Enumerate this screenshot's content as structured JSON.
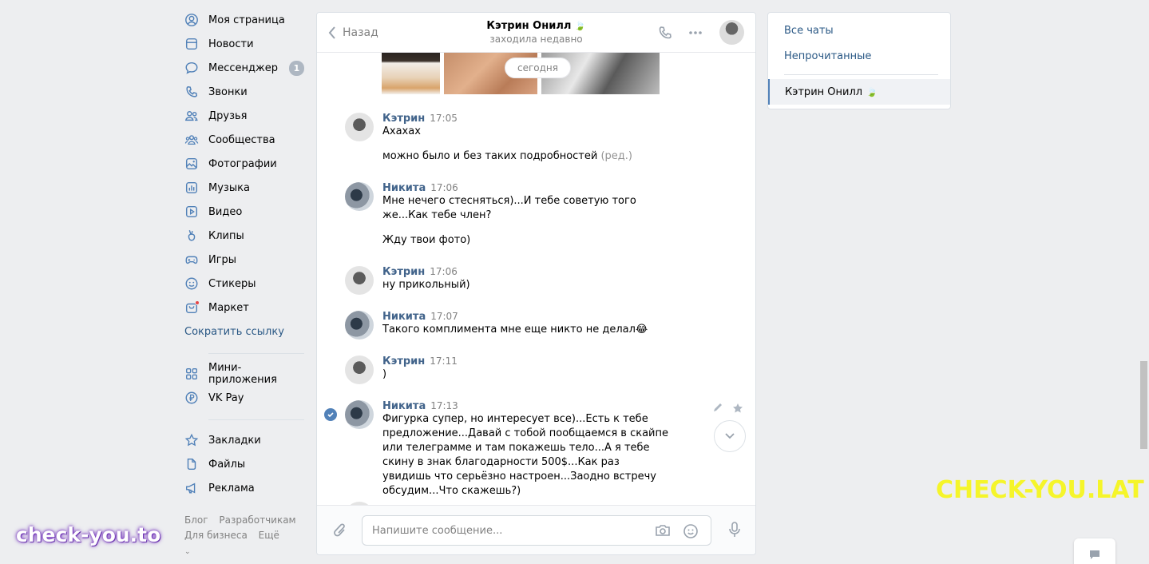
{
  "leftnav": {
    "items": [
      {
        "label": "Моя страница",
        "icon": "user-circle-icon"
      },
      {
        "label": "Новости",
        "icon": "news-icon"
      },
      {
        "label": "Мессенджер",
        "icon": "message-icon",
        "badge": "1"
      },
      {
        "label": "Звонки",
        "icon": "phone-icon"
      },
      {
        "label": "Друзья",
        "icon": "friends-icon"
      },
      {
        "label": "Сообщества",
        "icon": "communities-icon"
      },
      {
        "label": "Фотографии",
        "icon": "photo-icon"
      },
      {
        "label": "Музыка",
        "icon": "music-icon"
      },
      {
        "label": "Видео",
        "icon": "video-icon"
      },
      {
        "label": "Клипы",
        "icon": "clips-icon"
      },
      {
        "label": "Игры",
        "icon": "gamepad-icon"
      },
      {
        "label": "Стикеры",
        "icon": "smile-icon"
      },
      {
        "label": "Маркет",
        "icon": "market-icon"
      }
    ],
    "shorten_link": "Сократить ссылку",
    "items2": [
      {
        "label": "Мини-приложения",
        "icon": "apps-icon"
      },
      {
        "label": "VK Pay",
        "icon": "vkpay-icon"
      }
    ],
    "items3": [
      {
        "label": "Закладки",
        "icon": "star-icon"
      },
      {
        "label": "Файлы",
        "icon": "file-icon"
      },
      {
        "label": "Реклама",
        "icon": "megaphone-icon"
      }
    ],
    "footer": {
      "blog": "Блог",
      "dev": "Разработчикам",
      "business": "Для бизнеса",
      "more": "Ещё"
    }
  },
  "chat": {
    "back_label": "Назад",
    "peer_name": "Кэтрин Онилл",
    "peer_status": "заходила недавно",
    "date_label": "сегодня",
    "messages": [
      {
        "author": "Кэтрин",
        "time": "17:05",
        "lines": [
          "Ахахах"
        ],
        "extra": "можно было и без таких подробностей",
        "edited": "(ред.)"
      },
      {
        "author": "Никита",
        "time": "17:06",
        "lines": [
          "Мне нечего стесняться)...И тебе советую того же...Как тебе член?"
        ],
        "extra": "Жду твои фото)"
      },
      {
        "author": "Кэтрин",
        "time": "17:06",
        "lines": [
          "ну прикольный)"
        ]
      },
      {
        "author": "Никита",
        "time": "17:07",
        "lines": [
          "Такого комплимента мне еще никто не делал😂"
        ]
      },
      {
        "author": "Кэтрин",
        "time": "17:11",
        "lines": [
          ")"
        ]
      },
      {
        "author": "Никита",
        "time": "17:13",
        "lines": [
          "Фигурка супер, но интересует все)...Есть к тебе предложение...Давай с тобой пообщаемся в скайпе или телеграмме и там покажешь тело...А я тебе скину в знак благодарности 500$...Как раз увидишь что серьёзно настроен...Заодно встречу обсудим...Что скажешь?)"
        ]
      }
    ],
    "input_placeholder": "Напишите сообщение..."
  },
  "rightpanel": {
    "all_chats": "Все чаты",
    "unread": "Непрочитанные",
    "active_chat": "Кэтрин Онилл"
  },
  "watermarks": {
    "left": "check-you.to",
    "right": "CHECK-YOU.LAT"
  },
  "colors": {
    "link": "#2a5885",
    "author": "#42648b",
    "accent": "#5181b8",
    "background": "#edeef0"
  }
}
